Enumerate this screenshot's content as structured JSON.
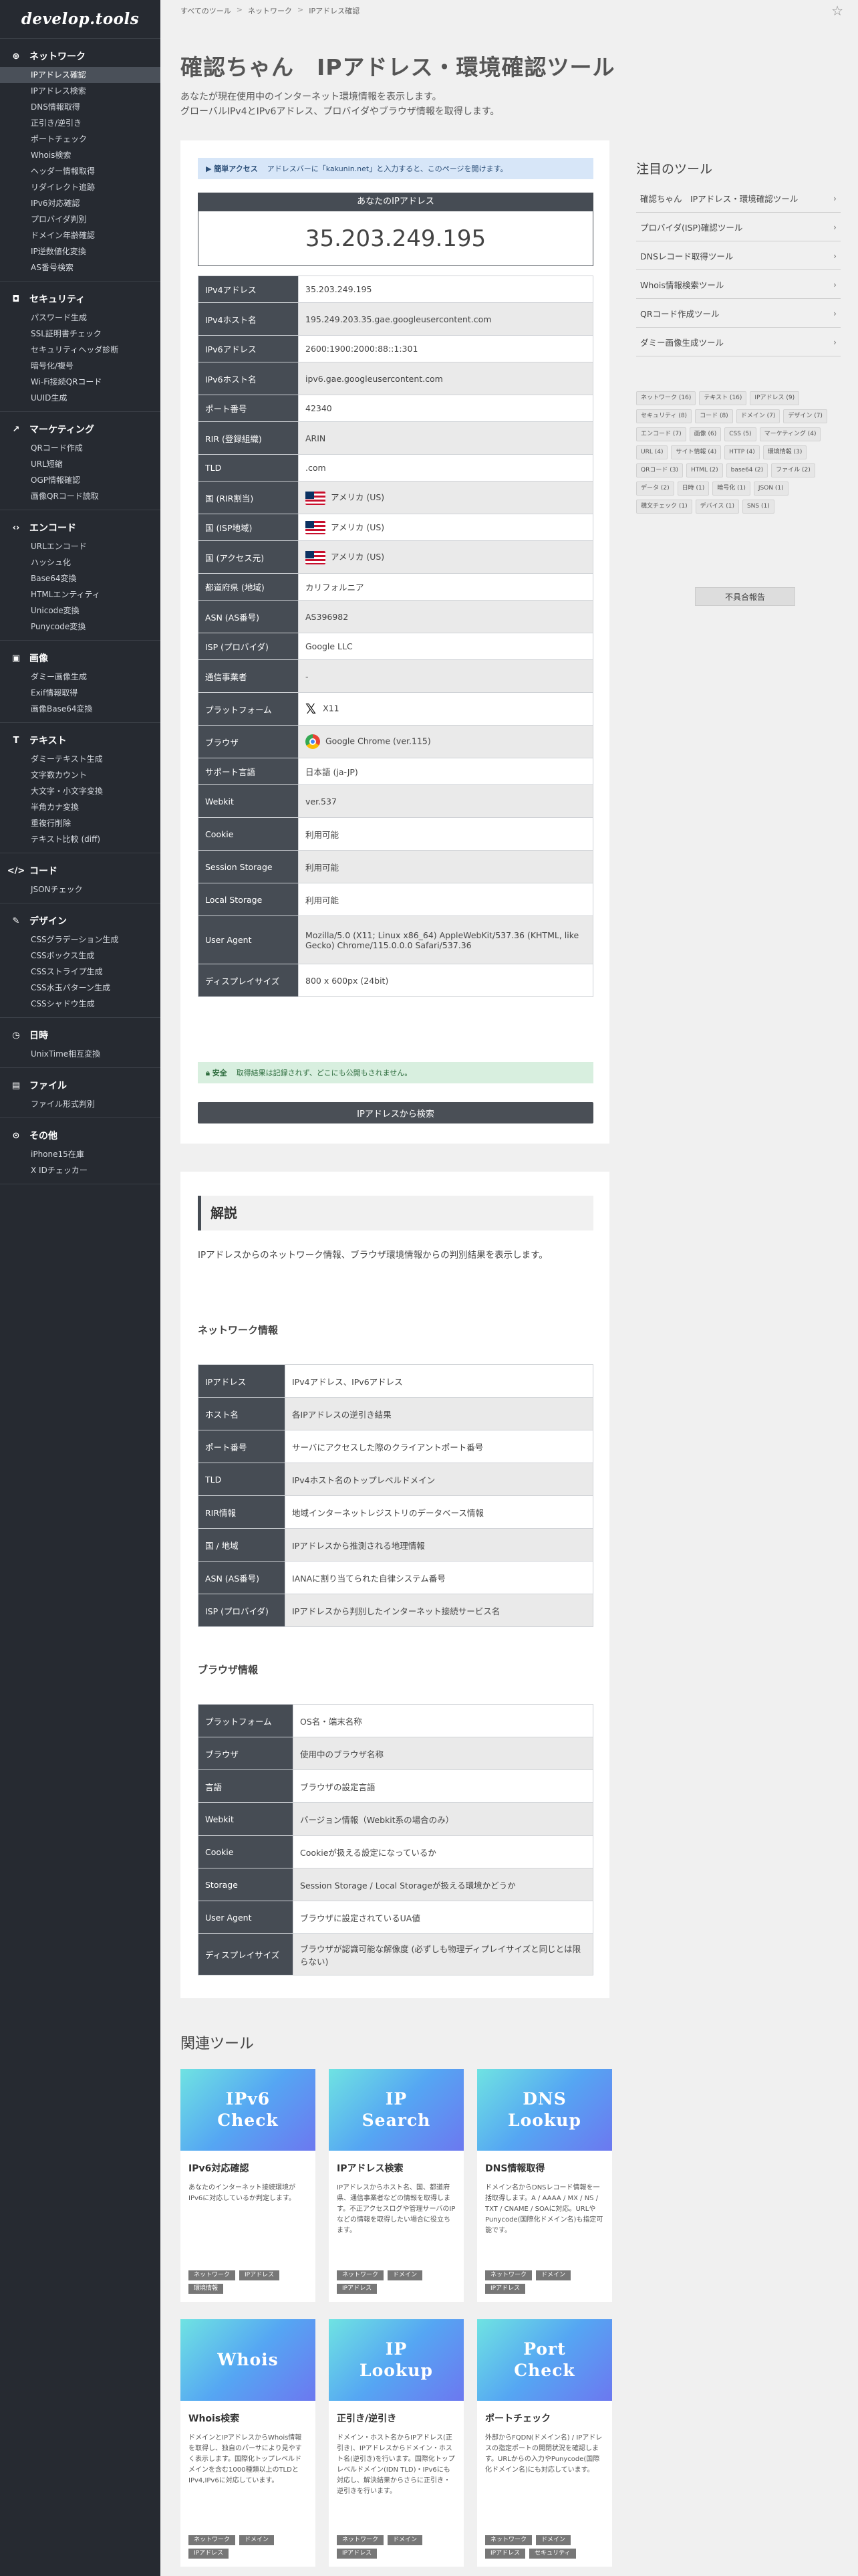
{
  "logo": "develop.tools",
  "sidebar": {
    "groups": [
      {
        "icon": "globe-icon",
        "glyph": "⊕",
        "title": "ネットワーク",
        "items": [
          "IPアドレス確認",
          "IPアドレス検索",
          "DNS情報取得",
          "正引き/逆引き",
          "ポートチェック",
          "Whois検索",
          "ヘッダー情報取得",
          "リダイレクト追跡",
          "IPv6対応確認",
          "プロバイダ判別",
          "ドメイン年齢確認",
          "IP逆数値化変換",
          "AS番号検索"
        ],
        "active": 0
      },
      {
        "icon": "shield-icon",
        "glyph": "◘",
        "title": "セキュリティ",
        "items": [
          "パスワード生成",
          "SSL証明書チェック",
          "セキュリティヘッダ診断",
          "暗号化/複号",
          "Wi-Fi接続QRコード",
          "UUID生成"
        ]
      },
      {
        "icon": "chart-icon",
        "glyph": "↗",
        "title": "マーケティング",
        "items": [
          "QRコード作成",
          "URL短縮",
          "OGP情報確認",
          "画像QRコード読取"
        ]
      },
      {
        "icon": "encode-icon",
        "glyph": "‹›",
        "title": "エンコード",
        "items": [
          "URLエンコード",
          "ハッシュ化",
          "Base64変換",
          "HTMLエンティティ",
          "Unicode変換",
          "Punycode変換"
        ]
      },
      {
        "icon": "image-icon",
        "glyph": "▣",
        "title": "画像",
        "items": [
          "ダミー画像生成",
          "Exif情報取得",
          "画像Base64変換"
        ]
      },
      {
        "icon": "text-icon",
        "glyph": "T",
        "title": "テキスト",
        "items": [
          "ダミーテキスト生成",
          "文字数カウント",
          "大文字・小文字変換",
          "半角カナ変換",
          "重複行削除",
          "テキスト比較 (diff)"
        ]
      },
      {
        "icon": "code-icon",
        "glyph": "</>",
        "title": "コード",
        "items": [
          "JSONチェック"
        ]
      },
      {
        "icon": "pen-icon",
        "glyph": "✎",
        "title": "デザイン",
        "items": [
          "CSSグラデーション生成",
          "CSSボックス生成",
          "CSSストライプ生成",
          "CSS水玉パターン生成",
          "CSSシャドウ生成"
        ]
      },
      {
        "icon": "clock-icon",
        "glyph": "◷",
        "title": "日時",
        "items": [
          "UnixTime相互変換"
        ]
      },
      {
        "icon": "folder-icon",
        "glyph": "▤",
        "title": "ファイル",
        "items": [
          "ファイル形式判別"
        ]
      },
      {
        "icon": "more-icon",
        "glyph": "⊙",
        "title": "その他",
        "items": [
          "iPhone15在庫",
          "X IDチェッカー"
        ]
      }
    ]
  },
  "breadcrumb": [
    "すべてのツール",
    "ネットワーク",
    "IPアドレス確認"
  ],
  "page": {
    "title": "確認ちゃん　IPアドレス・環境確認ツール",
    "desc1": "あなたが現在使用中のインターネット環境情報を表示します。",
    "desc2": "グローバルIPv4とIPv6アドレス、プロバイダやブラウザ情報を取得します。"
  },
  "tool": {
    "tip_label": "簡単アクセス",
    "tip_text": "アドレスバーに「kakunin.net」と入力すると、このページを開けます。",
    "ip_label": "あなたのIPアドレス",
    "ip": "35.203.249.195",
    "rows": [
      {
        "k": "IPv4アドレス",
        "v": "35.203.249.195",
        "h": 40
      },
      {
        "k": "IPv4ホスト名",
        "v": "195.249.203.35.gae.googleusercontent.com",
        "h": 49
      },
      {
        "k": "IPv6アドレス",
        "v": "2600:1900:2000:88::1:301",
        "h": 40
      },
      {
        "k": "IPv6ホスト名",
        "v": "ipv6.gae.googleusercontent.com",
        "h": 49
      },
      {
        "k": "ポート番号",
        "v": "42340",
        "h": 40
      },
      {
        "k": "RIR (登録組織)",
        "v": "ARIN",
        "h": 49
      },
      {
        "k": "TLD",
        "v": ".com",
        "h": 40
      },
      {
        "k": "国 (RIR割当)",
        "v": "アメリカ (US)",
        "flag": true,
        "h": 49
      },
      {
        "k": "国 (ISP地域)",
        "v": "アメリカ (US)",
        "flag": true,
        "h": 40
      },
      {
        "k": "国 (アクセス元)",
        "v": "アメリカ (US)",
        "flag": true,
        "h": 49
      },
      {
        "k": "都道府県 (地域)",
        "v": "カリフォルニア",
        "h": 40
      },
      {
        "k": "ASN (AS番号)",
        "v": "AS396982",
        "h": 49
      },
      {
        "k": "ISP (プロバイダ)",
        "v": "Google LLC",
        "h": 40
      },
      {
        "k": "通信事業者",
        "v": "-",
        "h": 49
      },
      {
        "k": "プラットフォーム",
        "v": "X11",
        "xlogo": true,
        "h": 49
      },
      {
        "k": "ブラウザ",
        "v": "Google Chrome (ver.115)",
        "chrome": true,
        "h": 49
      },
      {
        "k": "サポート言語",
        "v": "日本語 (ja-JP)",
        "h": 40
      },
      {
        "k": "Webkit",
        "v": "ver.537",
        "h": 49
      },
      {
        "k": "Cookie",
        "v": "利用可能",
        "h": 49
      },
      {
        "k": "Session Storage",
        "v": "利用可能",
        "h": 49
      },
      {
        "k": "Local Storage",
        "v": "利用可能",
        "h": 49
      },
      {
        "k": "User Agent",
        "v": "Mozilla/5.0 (X11; Linux x86_64) AppleWebKit/537.36 (KHTML, like Gecko) Chrome/115.0.0.0 Safari/537.36",
        "h": 72
      },
      {
        "k": "ディスプレイサイズ",
        "v": "800 x 600px (24bit)",
        "h": 49
      }
    ],
    "safe_label": "安全",
    "safe_text": "取得結果は記録されず、どこにも公開もされません。",
    "button": "IPアドレスから検索"
  },
  "featured": {
    "title": "注目のツール",
    "items": [
      "確認ちゃん　IPアドレス・環境確認ツール",
      "プロバイダ(ISP)確認ツール",
      "DNSレコード取得ツール",
      "Whois情報検索ツール",
      "QRコード作成ツール",
      "ダミー画像生成ツール"
    ]
  },
  "tags": [
    "ネットワーク (16)",
    "テキスト (16)",
    "IPアドレス (9)",
    "セキュリティ (8)",
    "コード (8)",
    "ドメイン (7)",
    "デザイン (7)",
    "エンコード (7)",
    "画像 (6)",
    "CSS (5)",
    "マーケティング (4)",
    "URL (4)",
    "サイト情報 (4)",
    "HTTP (4)",
    "環境情報 (3)",
    "QRコード (3)",
    "HTML (2)",
    "base64 (2)",
    "ファイル (2)",
    "データ (2)",
    "日時 (1)",
    "暗号化 (1)",
    "JSON (1)",
    "構文チェック (1)",
    "デバイス (1)",
    "SNS (1)"
  ],
  "report_button": "不具合報告",
  "explain": {
    "heading": "解説",
    "text": "IPアドレスからのネットワーク情報、ブラウザ環境情報からの判別結果を表示します。",
    "net_heading": "ネットワーク情報",
    "net_rows": [
      {
        "k": "IPアドレス",
        "v": "IPv4アドレス、IPv6アドレス",
        "h": 49
      },
      {
        "k": "ホスト名",
        "v": "各IPアドレスの逆引き結果",
        "h": 49
      },
      {
        "k": "ポート番号",
        "v": "サーバにアクセスした際のクライアントポート番号",
        "h": 49
      },
      {
        "k": "TLD",
        "v": "IPv4ホスト名のトップレベルドメイン",
        "h": 49
      },
      {
        "k": "RIR情報",
        "v": "地域インターネットレジストリのデータベース情報",
        "h": 49
      },
      {
        "k": "国 / 地域",
        "v": "IPアドレスから推測される地理情報",
        "h": 49
      },
      {
        "k": "ASN (AS番号)",
        "v": "IANAに割り当てられた自律システム番号",
        "h": 49
      },
      {
        "k": "ISP (プロバイダ)",
        "v": "IPアドレスから判別したインターネット接続サービス名",
        "h": 49
      }
    ],
    "br_heading": "ブラウザ情報",
    "br_rows": [
      {
        "k": "プラットフォーム",
        "v": "OS名・端末名称",
        "h": 49
      },
      {
        "k": "ブラウザ",
        "v": "使用中のブラウザ名称",
        "h": 49
      },
      {
        "k": "言語",
        "v": "ブラウザの設定言語",
        "h": 49
      },
      {
        "k": "Webkit",
        "v": "バージョン情報（Webkit系の場合のみ）",
        "h": 49
      },
      {
        "k": "Cookie",
        "v": "Cookieが扱える設定になっているか",
        "h": 49
      },
      {
        "k": "Storage",
        "v": "Session Storage / Local Storageが扱える環境かどうか",
        "h": 49
      },
      {
        "k": "User Agent",
        "v": "ブラウザに設定されているUA値",
        "h": 49
      },
      {
        "k": "ディスプレイサイズ",
        "v": "ブラウザが認識可能な解像度 (必ずしも物理ディプレイサイズと同じとは限らない)",
        "h": 62
      }
    ]
  },
  "related": {
    "title": "関連ツール",
    "cards": [
      {
        "thumb": "IPv6\nCheck",
        "name": "IPv6対応確認",
        "desc": "あなたのインターネット接続環境がIPv6に対応しているか判定します。",
        "tags": [
          "ネットワーク",
          "IPアドレス",
          "環境情報"
        ]
      },
      {
        "thumb": "IP\nSearch",
        "name": "IPアドレス検索",
        "desc": "IPアドレスからホスト名、国、都道府県、通信事業者などの情報を取得します。不正アクセスログや管理サーバのIPなどの情報を取得したい場合に役立ちます。",
        "tags": [
          "ネットワーク",
          "ドメイン",
          "IPアドレス"
        ]
      },
      {
        "thumb": "DNS\nLookup",
        "name": "DNS情報取得",
        "desc": "ドメイン名からDNSレコード情報を一括取得します。A / AAAA / MX / NS / TXT / CNAME / SOAに対応。URLやPunycode(国際化ドメイン名)も指定可能です。",
        "tags": [
          "ネットワーク",
          "ドメイン",
          "IPアドレス"
        ]
      },
      {
        "thumb": "Whois",
        "name": "Whois検索",
        "desc": "ドメインとIPアドレスからWhois情報を取得し、独自のパーサにより見やすく表示します。国際化トップレベルドメインを含む1000種類以上のTLDとIPv4,IPv6に対応しています。",
        "tags": [
          "ネットワーク",
          "ドメイン",
          "IPアドレス"
        ]
      },
      {
        "thumb": "IP\nLookup",
        "name": "正引き/逆引き",
        "desc": "ドメイン・ホスト名からIPアドレス(正引き)、IPアドレスからドメイン・ホスト名(逆引き)を行います。国際化トップレベルドメイン(IDN TLD)・IPv6にも対応し、解決結果からさらに正引き・逆引きを行います。",
        "tags": [
          "ネットワーク",
          "ドメイン",
          "IPアドレス"
        ]
      },
      {
        "thumb": "Port\nCheck",
        "name": "ポートチェック",
        "desc": "外部からFQDN(ドメイン名) / IPアドレスの指定ポートの開閉状況を確認します。URLからの入力やPunycode(国際化ドメイン名)にも対応しています。",
        "tags": [
          "ネットワーク",
          "ドメイン",
          "IPアドレス",
          "セキュリティ"
        ]
      }
    ]
  },
  "colors": {
    "sidebar": "#262a31",
    "header_cell": "#464c54",
    "tip_bg": "#d7e6f8",
    "safe_bg": "#d8efdf",
    "thumb_from": "#6fe3e2",
    "thumb_to": "#6c78f0"
  }
}
